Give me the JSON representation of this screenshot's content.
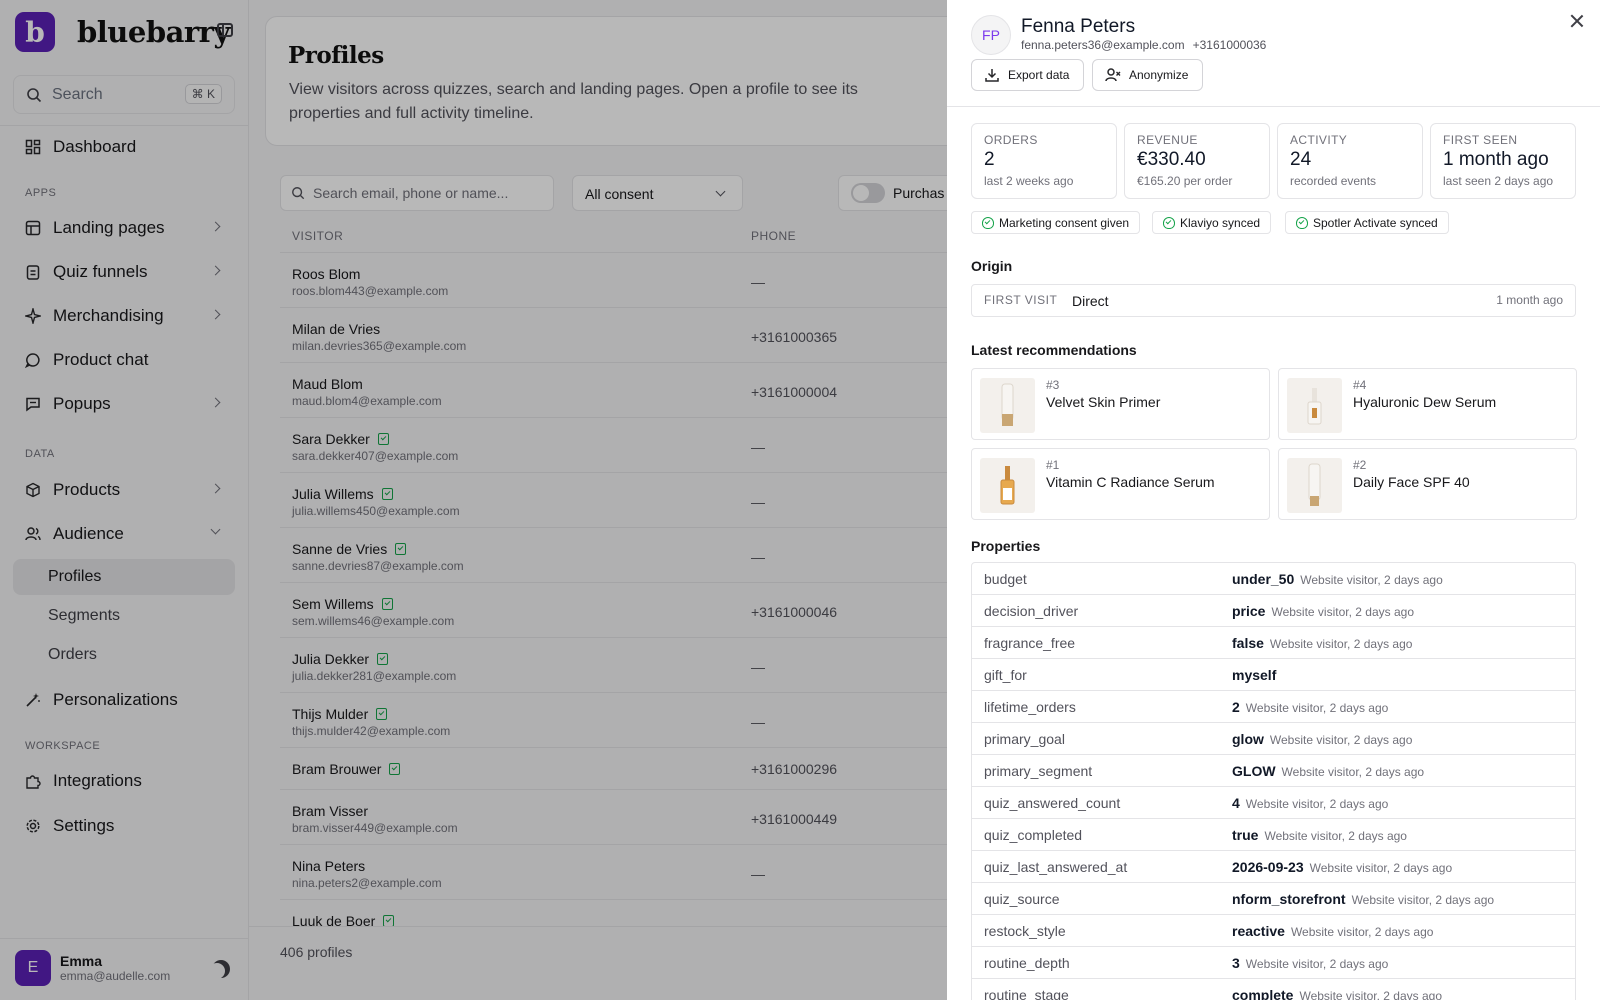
{
  "sidebar": {
    "brand_letter": "b",
    "brand_name": "bluebarry",
    "search_label": "Search",
    "search_shortcut": "⌘ K",
    "dashboard": "Dashboard",
    "section_apps": "APPS",
    "apps": [
      "Landing pages",
      "Quiz funnels",
      "Merchandising",
      "Product chat",
      "Popups"
    ],
    "section_data": "DATA",
    "products": "Products",
    "audience": "Audience",
    "audience_sub": [
      "Profiles",
      "Segments",
      "Orders"
    ],
    "personalizations": "Personalizations",
    "section_workspace": "WORKSPACE",
    "integrations": "Integrations",
    "settings": "Settings",
    "user": {
      "initial": "E",
      "name": "Emma",
      "email": "emma@audelle.com"
    }
  },
  "main": {
    "title": "Profiles",
    "description": "View visitors across quizzes, search and landing pages. Open a profile to see its properties and full activity timeline.",
    "search_placeholder": "Search email, phone or name...",
    "consent_filter": "All consent",
    "toggle_label": "Purchas",
    "col_visitor": "VISITOR",
    "col_phone": "PHONE",
    "rows": [
      {
        "name": "Roos Blom",
        "email": "roos.blom443@example.com",
        "phone": "—",
        "verified": false
      },
      {
        "name": "Milan de Vries",
        "email": "milan.devries365@example.com",
        "phone": "+3161000365",
        "verified": false
      },
      {
        "name": "Maud Blom",
        "email": "maud.blom4@example.com",
        "phone": "+3161000004",
        "verified": false
      },
      {
        "name": "Sara Dekker",
        "email": "sara.dekker407@example.com",
        "phone": "—",
        "verified": true
      },
      {
        "name": "Julia Willems",
        "email": "julia.willems450@example.com",
        "phone": "—",
        "verified": true
      },
      {
        "name": "Sanne de Vries",
        "email": "sanne.devries87@example.com",
        "phone": "—",
        "verified": true
      },
      {
        "name": "Sem Willems",
        "email": "sem.willems46@example.com",
        "phone": "+3161000046",
        "verified": true
      },
      {
        "name": "Julia Dekker",
        "email": "julia.dekker281@example.com",
        "phone": "—",
        "verified": true
      },
      {
        "name": "Thijs Mulder",
        "email": "thijs.mulder42@example.com",
        "phone": "—",
        "verified": true
      },
      {
        "name": "Bram Brouwer",
        "email": "",
        "phone": "+3161000296",
        "verified": true
      },
      {
        "name": "Bram Visser",
        "email": "bram.visser449@example.com",
        "phone": "+3161000449",
        "verified": false
      },
      {
        "name": "Nina Peters",
        "email": "nina.peters2@example.com",
        "phone": "—",
        "verified": false
      },
      {
        "name": "Luuk de Boer",
        "email": "",
        "phone": "",
        "verified": true
      }
    ],
    "footer": "406 profiles"
  },
  "drawer": {
    "initials": "FP",
    "name": "Fenna Peters",
    "email": "fenna.peters36@example.com",
    "phone": "+3161000036",
    "export_label": "Export data",
    "anonymize_label": "Anonymize",
    "stats": [
      {
        "label": "ORDERS",
        "value": "2",
        "sub": "last 2 weeks ago"
      },
      {
        "label": "REVENUE",
        "value": "€330.40",
        "sub": "€165.20 per order"
      },
      {
        "label": "ACTIVITY",
        "value": "24",
        "sub": "recorded events"
      },
      {
        "label": "FIRST SEEN",
        "value": "1 month ago",
        "sub": "last seen 2 days ago"
      }
    ],
    "chips": [
      "Marketing consent given",
      "Klaviyo synced",
      "Spotler Activate synced"
    ],
    "origin_title": "Origin",
    "origin": {
      "key": "FIRST VISIT",
      "value": "Direct",
      "time": "1 month ago"
    },
    "recs_title": "Latest recommendations",
    "recs": [
      {
        "rank": "#3",
        "title": "Velvet Skin Primer"
      },
      {
        "rank": "#4",
        "title": "Hyaluronic Dew Serum"
      },
      {
        "rank": "#1",
        "title": "Vitamin C Radiance Serum"
      },
      {
        "rank": "#2",
        "title": "Daily Face SPF 40"
      }
    ],
    "props_title": "Properties",
    "props": [
      {
        "key": "budget",
        "value": "under_50",
        "meta": "Website visitor, 2 days ago"
      },
      {
        "key": "decision_driver",
        "value": "price",
        "meta": "Website visitor, 2 days ago"
      },
      {
        "key": "fragrance_free",
        "value": "false",
        "meta": "Website visitor, 2 days ago"
      },
      {
        "key": "gift_for",
        "value": "myself",
        "meta": ""
      },
      {
        "key": "lifetime_orders",
        "value": "2",
        "meta": "Website visitor, 2 days ago"
      },
      {
        "key": "primary_goal",
        "value": "glow",
        "meta": "Website visitor, 2 days ago"
      },
      {
        "key": "primary_segment",
        "value": "GLOW",
        "meta": "Website visitor, 2 days ago"
      },
      {
        "key": "quiz_answered_count",
        "value": "4",
        "meta": "Website visitor, 2 days ago"
      },
      {
        "key": "quiz_completed",
        "value": "true",
        "meta": "Website visitor, 2 days ago"
      },
      {
        "key": "quiz_last_answered_at",
        "value": "2026-09-23",
        "meta": "Website visitor, 2 days ago"
      },
      {
        "key": "quiz_source",
        "value": "nform_storefront",
        "meta": "Website visitor, 2 days ago"
      },
      {
        "key": "restock_style",
        "value": "reactive",
        "meta": "Website visitor, 2 days ago"
      },
      {
        "key": "routine_depth",
        "value": "3",
        "meta": "Website visitor, 2 days ago"
      },
      {
        "key": "routine_stage",
        "value": "complete",
        "meta": "Website visitor, 2 days ago"
      }
    ]
  },
  "colors": {
    "brand": "#5b21b6",
    "success": "#16a34a",
    "overlay": "rgba(0,0,0,0.28)"
  }
}
